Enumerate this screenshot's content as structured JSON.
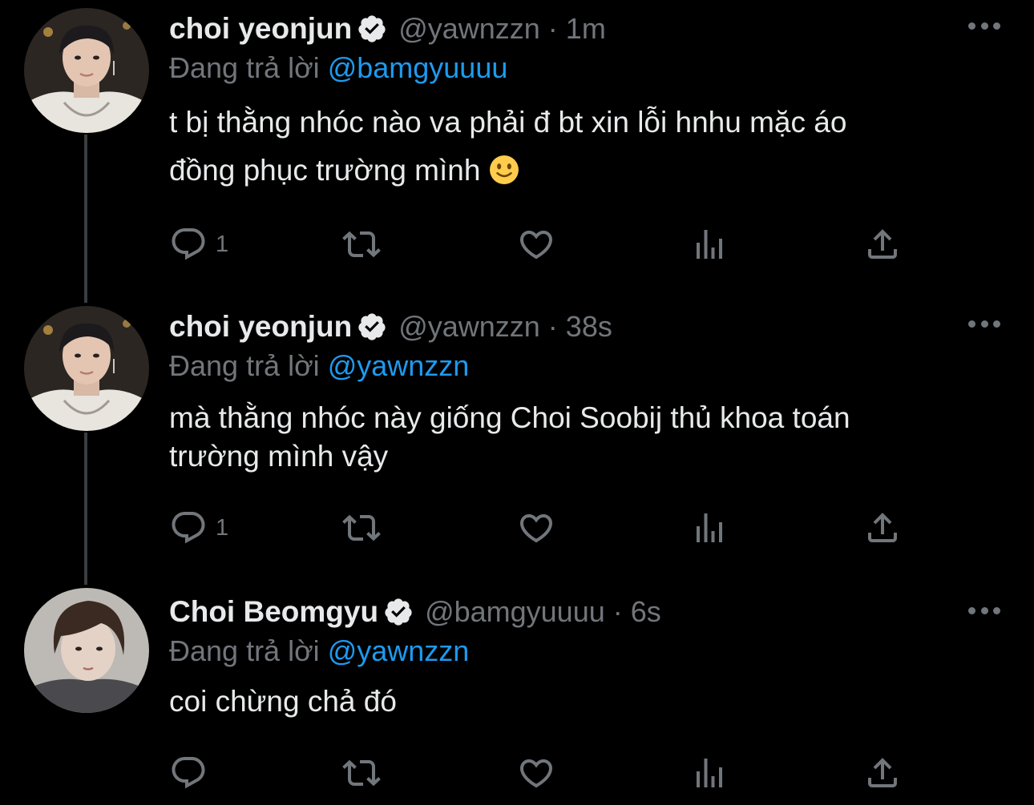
{
  "tweets": [
    {
      "name": "choi yeonjun",
      "handle": "@yawnzzn",
      "time": "1m",
      "reply_prefix": "Đang trả lời ",
      "reply_to": "@bamgyuuuu",
      "text_line1": "t bị thằng nhóc nào va phải đ bt xin lỗi hnhu mặc áo",
      "text_line2": "đồng phục trường mình",
      "emoji": "slightly-smiling-face",
      "reply_count": "1"
    },
    {
      "name": "choi yeonjun",
      "handle": "@yawnzzn",
      "time": "38s",
      "reply_prefix": "Đang trả lời ",
      "reply_to": "@yawnzzn",
      "text_line1": "mà thằng nhóc này giống Choi Soobij thủ khoa toán",
      "text_line2": "trường mình vậy",
      "reply_count": "1"
    },
    {
      "name": "Choi Beomgyu",
      "handle": "@bamgyuuuu",
      "time": "6s",
      "reply_prefix": "Đang trả lời ",
      "reply_to": "@yawnzzn",
      "text_line1": "coi chừng chả đó",
      "reply_count": ""
    }
  ],
  "separator": "·",
  "colors": {
    "background": "#000000",
    "text": "#e7e9ea",
    "muted": "#71767b",
    "link": "#1d9bf0",
    "thread_line": "#3a3d41"
  },
  "icons": [
    "verified-badge-icon",
    "more-icon",
    "reply-icon",
    "retweet-icon",
    "like-icon",
    "views-icon",
    "share-icon"
  ]
}
